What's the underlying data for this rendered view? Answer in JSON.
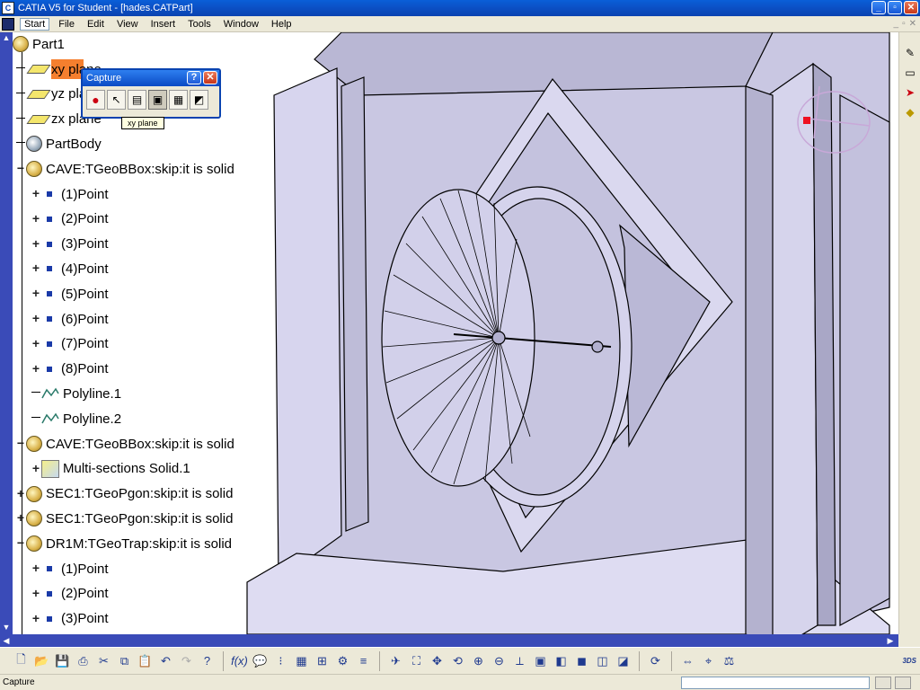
{
  "window": {
    "title": "CATIA V5 for Student - [hades.CATPart]",
    "buttons": {
      "minimize": "_",
      "maximize": "▫",
      "close": "✕"
    }
  },
  "menu": {
    "items": [
      "Start",
      "File",
      "Edit",
      "View",
      "Insert",
      "Tools",
      "Window",
      "Help"
    ]
  },
  "tree": {
    "root": "Part1",
    "items": [
      {
        "label": "xy plane",
        "icon": "plane-icon",
        "level": 1,
        "expander": ""
      },
      {
        "label": "yz plane",
        "icon": "plane-icon",
        "level": 1,
        "expander": ""
      },
      {
        "label": "zx plane",
        "icon": "plane-icon",
        "level": 1,
        "expander": ""
      },
      {
        "label": "PartBody",
        "icon": "body-icon",
        "level": 1,
        "expander": ""
      },
      {
        "label": "CAVE:TGeoBBox:skip:it is solid",
        "icon": "gear-icon",
        "level": 1,
        "expander": "−"
      },
      {
        "label": "(1)Point",
        "icon": "point-icon",
        "level": 2,
        "expander": "+"
      },
      {
        "label": "(2)Point",
        "icon": "point-icon",
        "level": 2,
        "expander": "+"
      },
      {
        "label": "(3)Point",
        "icon": "point-icon",
        "level": 2,
        "expander": "+"
      },
      {
        "label": "(4)Point",
        "icon": "point-icon",
        "level": 2,
        "expander": "+"
      },
      {
        "label": "(5)Point",
        "icon": "point-icon",
        "level": 2,
        "expander": "+"
      },
      {
        "label": "(6)Point",
        "icon": "point-icon",
        "level": 2,
        "expander": "+"
      },
      {
        "label": "(7)Point",
        "icon": "point-icon",
        "level": 2,
        "expander": "+"
      },
      {
        "label": "(8)Point",
        "icon": "point-icon",
        "level": 2,
        "expander": "+"
      },
      {
        "label": "Polyline.1",
        "icon": "polyline-icon",
        "level": 2,
        "expander": ""
      },
      {
        "label": "Polyline.2",
        "icon": "polyline-icon",
        "level": 2,
        "expander": ""
      },
      {
        "label": "CAVE:TGeoBBox:skip:it is solid",
        "icon": "gear-icon",
        "level": 1,
        "expander": "−"
      },
      {
        "label": "Multi-sections Solid.1",
        "icon": "multi-section-icon",
        "level": 2,
        "expander": "+"
      },
      {
        "label": "SEC1:TGeoPgon:skip:it is solid",
        "icon": "gear-icon",
        "level": 1,
        "expander": "+"
      },
      {
        "label": "SEC1:TGeoPgon:skip:it is solid",
        "icon": "gear-icon",
        "level": 1,
        "expander": "+"
      },
      {
        "label": "DR1M:TGeoTrap:skip:it is solid",
        "icon": "gear-icon",
        "level": 1,
        "expander": "−"
      },
      {
        "label": "(1)Point",
        "icon": "point-icon",
        "level": 2,
        "expander": "+"
      },
      {
        "label": "(2)Point",
        "icon": "point-icon",
        "level": 2,
        "expander": "+"
      },
      {
        "label": "(3)Point",
        "icon": "point-icon",
        "level": 2,
        "expander": "+"
      }
    ]
  },
  "capture": {
    "title": "Capture",
    "tooltip": "xy plane",
    "tools": [
      "record-icon",
      "select-icon",
      "options-icon",
      "capture-icon",
      "album-icon",
      "settings-icon"
    ]
  },
  "status": {
    "text": "Capture"
  },
  "colors": {
    "viewport_bg": "#ffffff",
    "model_fill": "#cfcde8",
    "model_edge": "#000000",
    "selection_highlight": "#f57f2e",
    "scrollbar": "#3a4bb8"
  }
}
